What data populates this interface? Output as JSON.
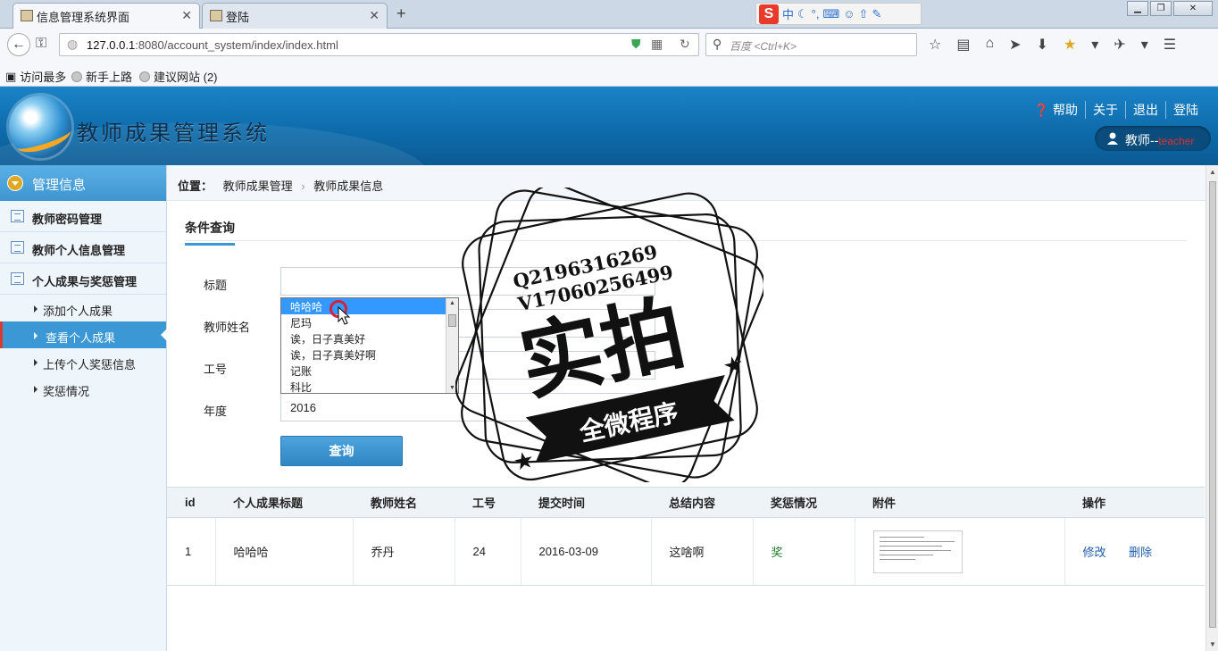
{
  "browser": {
    "tabs": [
      {
        "label": "信息管理系统界面",
        "active": true
      },
      {
        "label": "登陆",
        "active": false
      }
    ],
    "url_host": "127.0.0.1",
    "url_path": ":8080/account_system/index/index.html",
    "search_placeholder": "百度 <Ctrl+K>",
    "bookmarks": [
      "访问最多",
      "新手上路",
      "建议网站 (2)"
    ],
    "ext_label": "中"
  },
  "header": {
    "app_title": "教师成果管理系统",
    "links": [
      "帮助",
      "关于",
      "退出",
      "登陆"
    ],
    "user_prefix": "教师--",
    "user_role": "teacher"
  },
  "sidebar": {
    "title": "管理信息",
    "items": [
      "教师密码管理",
      "教师个人信息管理",
      "个人成果与奖惩管理"
    ],
    "subitems": [
      "添加个人成果",
      "查看个人成果",
      "上传个人奖惩信息",
      "奖惩情况"
    ],
    "active_subitem": "查看个人成果"
  },
  "breadcrumb": {
    "label": "位置：",
    "path": [
      "教师成果管理",
      "教师成果信息"
    ]
  },
  "search_form": {
    "tab": "条件查询",
    "fields": {
      "title_label": "标题",
      "teacher_label": "教师姓名",
      "id_label": "工号",
      "year_label": "年度",
      "year_value": "2016"
    },
    "dropdown_options": [
      "哈哈哈",
      "尼玛",
      "诶，日子真美好",
      "诶，日子真美好啊",
      "记账",
      "科比"
    ],
    "query_button": "查询"
  },
  "table": {
    "headers": [
      "id",
      "个人成果标题",
      "教师姓名",
      "工号",
      "提交时间",
      "总结内容",
      "奖惩情况",
      "附件",
      "操作"
    ],
    "rows": [
      {
        "id": "1",
        "title": "哈哈哈",
        "teacher": "乔丹",
        "job_no": "24",
        "time": "2016-03-09",
        "summary": "这啥啊",
        "reward": "奖",
        "edit": "修改",
        "delete": "删除"
      }
    ]
  },
  "watermark": {
    "line1": "Q2196316269",
    "line2": "V17060256499",
    "big": "实拍",
    "banner": "全微程序"
  }
}
